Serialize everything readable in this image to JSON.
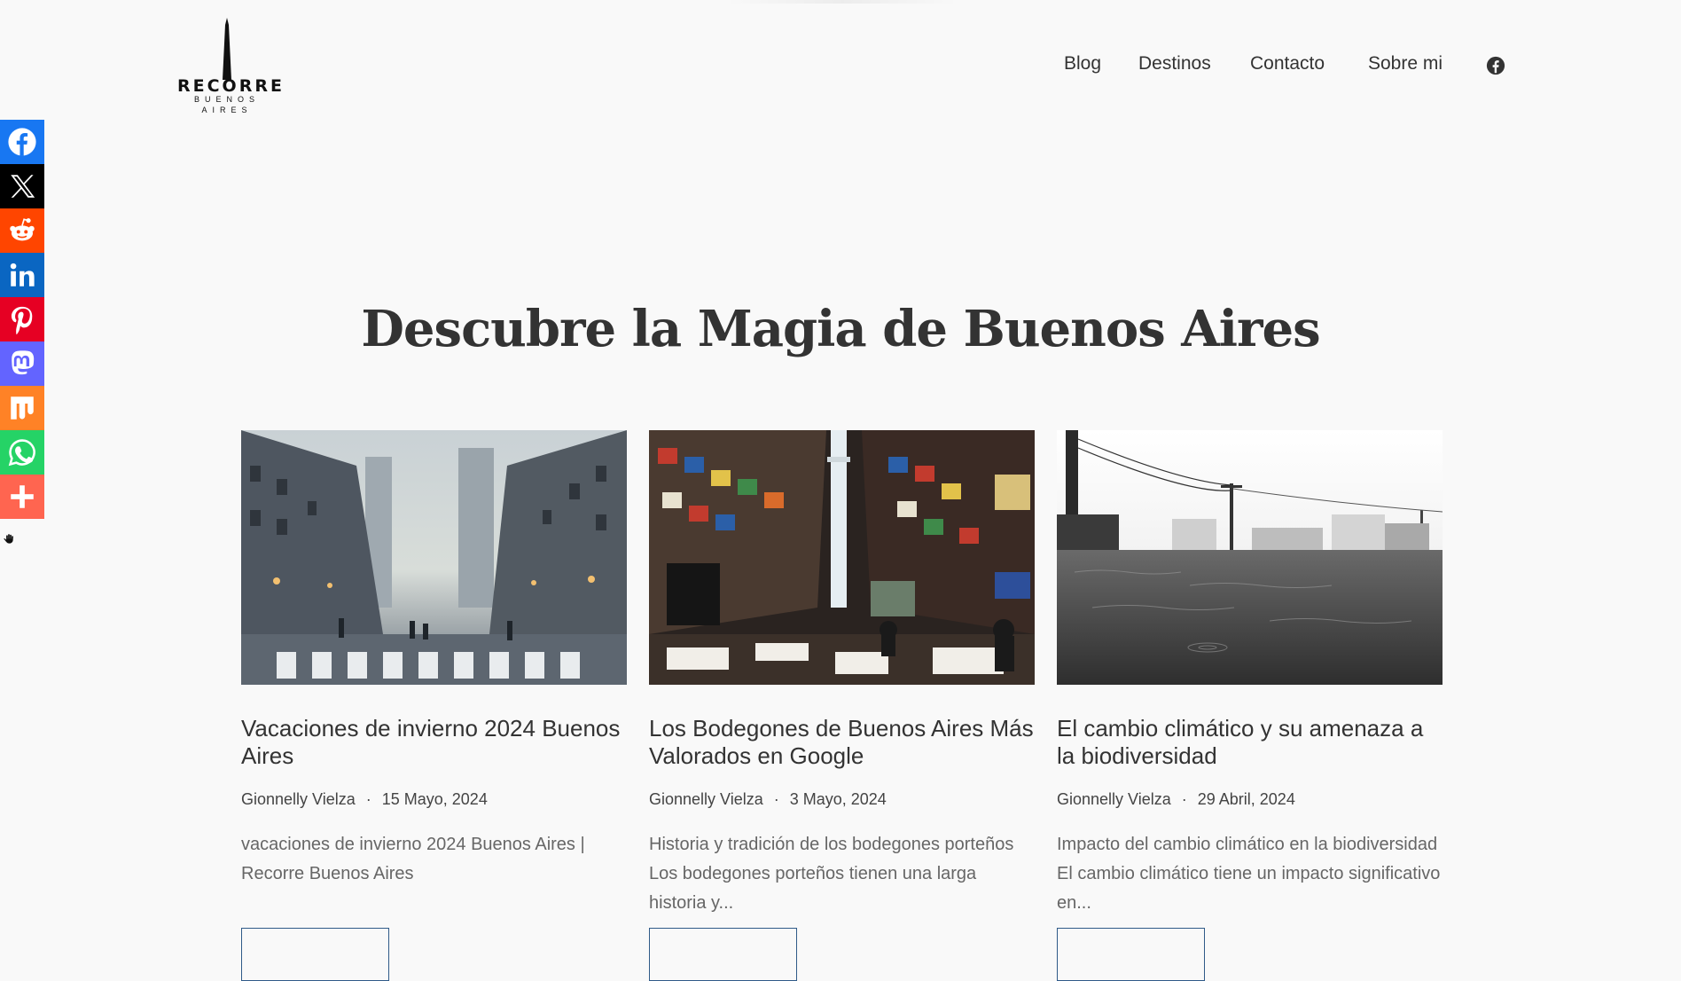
{
  "header": {
    "logo": {
      "line1": "RECORRE",
      "line2": "BUENOS",
      "line3": "AIRES"
    },
    "nav": [
      {
        "label": "Blog"
      },
      {
        "label": "Destinos"
      },
      {
        "label": "Contacto"
      },
      {
        "label": "Sobre mi"
      }
    ],
    "social_icon": "facebook-icon"
  },
  "share_bar": [
    {
      "name": "facebook",
      "color": "#1877f2"
    },
    {
      "name": "x",
      "color": "#000000"
    },
    {
      "name": "reddit",
      "color": "#ff4500"
    },
    {
      "name": "linkedin",
      "color": "#0a66c2"
    },
    {
      "name": "pinterest",
      "color": "#e60023"
    },
    {
      "name": "mastodon",
      "color": "#6364ff"
    },
    {
      "name": "mix",
      "color": "#ff8226"
    },
    {
      "name": "whatsapp",
      "color": "#25d366"
    },
    {
      "name": "more",
      "color": "#ff6550"
    }
  ],
  "main": {
    "heading": "Descubre la Magia de Buenos Aires",
    "posts": [
      {
        "title": "Vacaciones de invierno 2024 Buenos Aires",
        "author": "Gionnelly Vielza",
        "date": "15 Mayo, 2024",
        "excerpt": "vacaciones de invierno 2024 Buenos Aires | Recorre Buenos Aires"
      },
      {
        "title": "Los Bodegones de Buenos Aires Más Valorados en Google",
        "author": "Gionnelly Vielza",
        "date": "3 Mayo, 2024",
        "excerpt": "Historia y tradición de los bodegones porteños Los bodegones porteños tienen una larga historia y..."
      },
      {
        "title": "El cambio climático y su amenaza a la biodiversidad",
        "author": "Gionnelly Vielza",
        "date": "29 Abril, 2024",
        "excerpt": "Impacto del cambio climático en la biodiversidad El cambio climático tiene un impacto significativo en..."
      }
    ]
  },
  "colors": {
    "button_border": "#2f5a88",
    "background": "#f9f9f9"
  }
}
